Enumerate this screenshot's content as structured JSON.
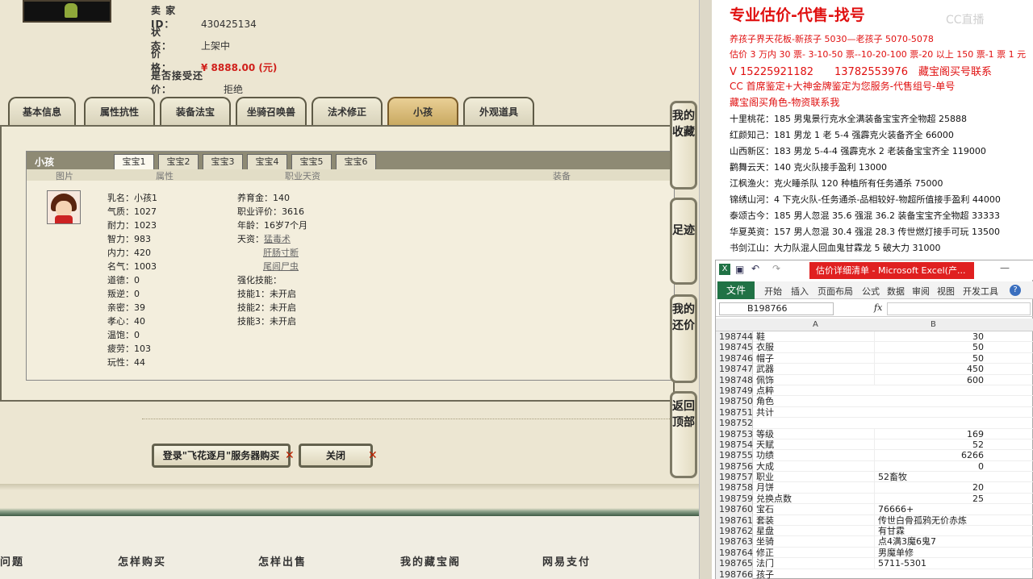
{
  "seller": {
    "id_label": "卖 家  ID：",
    "id_value": "430425134",
    "status_label": "状　　态：",
    "status_value": "上架中",
    "price_label": "价　　格：",
    "price_value": "¥ 8888.00 (元)",
    "bargain_label": "是否接受还价：",
    "bargain_value": "拒绝"
  },
  "tabs": [
    "基本信息",
    "属性抗性",
    "装备法宝",
    "坐骑召唤兽",
    "法术修正",
    "小孩",
    "外观道具"
  ],
  "active_tab": "小孩",
  "panel": {
    "title": "小孩",
    "baby_tabs": [
      "宝宝1",
      "宝宝2",
      "宝宝3",
      "宝宝4",
      "宝宝5",
      "宝宝6"
    ],
    "columns": [
      "图片",
      "属性",
      "职业天资",
      "装备"
    ],
    "col1": [
      "乳名：小孩1",
      "气质：1027",
      "耐力：1023",
      "智力：983",
      "内力：420",
      "名气：1003",
      "道德：0",
      "叛逆：0",
      "亲密：39",
      "孝心：40",
      "温饱：0",
      "疲劳：103",
      "玩性：44"
    ],
    "col2_top": [
      "养育金：140",
      "职业评价：3616",
      "年龄：16岁7个月"
    ],
    "talent_label": "天资：",
    "talents": [
      "猛毒术",
      "肝肠寸断",
      "尾闾尸虫"
    ],
    "skills_label": "强化技能：",
    "skills": [
      "技能1：未开启",
      "技能2：未开启",
      "技能3：未开启"
    ]
  },
  "side_buttons": [
    "我的收藏",
    "足迹",
    "我的还价",
    "返回顶部"
  ],
  "buttons": {
    "login": "登录\"飞花逐月\"服务器购买",
    "close": "关闭"
  },
  "footer": [
    "问题",
    "怎样购买",
    "怎样出售",
    "我的藏宝阁",
    "网易支付"
  ],
  "ad": {
    "headline": "专业估价-代售-找号",
    "lines_red": [
      "养孩子界天花板-新孩子 5030—老孩子 5070-5078",
      "估价 3 万内 30 票- 3-10-50 票--10-20-100 票-20 以上 150 票-1 票 1 元",
      "V 15225921182　　13782553976　藏宝阁买号联系",
      "CC 首席鉴定+大神金牌鉴定为您服务-代售组号-单号",
      "藏宝阁买角色-物资联系我"
    ],
    "lines_black": [
      "十里桃花：185 男鬼景行克水全满装备宝宝齐全物超 25888",
      "红颜知己：181 男龙 1 老 5-4 强霹克火装备齐全 66000",
      "山西新区：183 男龙 5-4-4 强霹克水 2 老装备宝宝齐全 119000",
      "鹳舞云天：140 克火队接手盈利 13000",
      "江枫渔火：克火睡杀队 120 种植所有任务通杀 75000",
      "锦绣山河：4 下克火队-任务通杀-品相较好-物超所值接手盈利 44000",
      "泰颂古今：185 男人忽混 35.6 强混 36.2 装备宝宝齐全物超 33333",
      "华夏英资：157 男人忽混 30.4 强混 28.3 传世燃灯接手可玩 13500",
      "书剑江山：大力队混人回血鬼甘霖龙 5 破大力 31000"
    ],
    "watermark": "CC直播"
  },
  "excel": {
    "title": "估价详细清单 - Microsoft Excel(产...",
    "ribbon": [
      "文件",
      "开始",
      "插入",
      "页面布局",
      "公式",
      "数据",
      "审阅",
      "视图",
      "开发工具"
    ],
    "namebox": "B198766",
    "fx": "fx",
    "col_a": "A",
    "col_b": "B",
    "rows": [
      [
        "198744",
        "鞋",
        "30"
      ],
      [
        "198745",
        "衣服",
        "50"
      ],
      [
        "198746",
        "帽子",
        "50"
      ],
      [
        "198747",
        "武器",
        "450"
      ],
      [
        "198748",
        "佩饰",
        "600"
      ],
      [
        "198749",
        "点粹",
        ""
      ],
      [
        "198750",
        "角色",
        ""
      ],
      [
        "198751",
        "共计",
        ""
      ],
      [
        "198752",
        "",
        ""
      ],
      [
        "198753",
        "等级",
        "169"
      ],
      [
        "198754",
        "天赋",
        "52"
      ],
      [
        "198755",
        "功绩",
        "6266"
      ],
      [
        "198756",
        "大成",
        "0"
      ],
      [
        "198757",
        "职业",
        "52畜牧"
      ],
      [
        "198758",
        "月饼",
        "20"
      ],
      [
        "198759",
        "兑换点数",
        "25"
      ],
      [
        "198760",
        "宝石",
        "76666+"
      ],
      [
        "198761",
        "套装",
        "传世白骨孤鸦无价赤炼"
      ],
      [
        "198762",
        "星盘",
        "有甘霖"
      ],
      [
        "198763",
        "坐骑",
        "点4满3魔6鬼7"
      ],
      [
        "198764",
        "修正",
        "男魔单修"
      ],
      [
        "198765",
        "法门",
        "5711-5301"
      ],
      [
        "198766",
        "孩子",
        ""
      ]
    ]
  },
  "colors": {
    "accent_red": "#e01010",
    "excel_green": "#207245"
  }
}
